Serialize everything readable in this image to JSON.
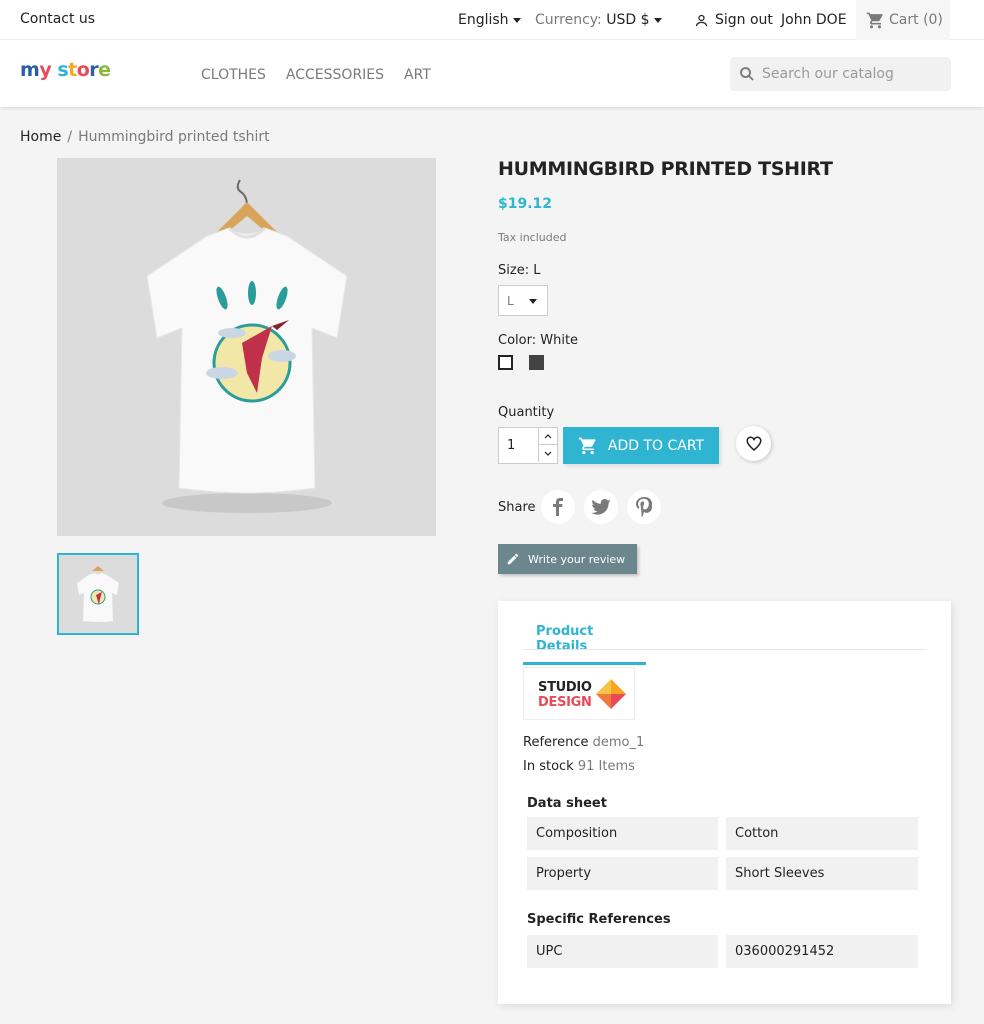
{
  "topbar": {
    "contact": "Contact us",
    "language": "English",
    "currency_label": "Currency:",
    "currency_value": "USD $",
    "signout": "Sign out",
    "user": "John DOE",
    "cart": "Cart",
    "cart_count": "(0)"
  },
  "header": {
    "logo": "my store",
    "nav": [
      "CLOTHES",
      "ACCESSORIES",
      "ART"
    ],
    "search_placeholder": "Search our catalog"
  },
  "breadcrumb": {
    "home": "Home",
    "sep": "/",
    "current": "Hummingbird printed tshirt"
  },
  "product": {
    "title": "HUMMINGBIRD PRINTED TSHIRT",
    "price": "$19.12",
    "tax": "Tax included",
    "size_label": "Size",
    "size_value": "L",
    "color_label": "Color",
    "color_value": "White",
    "colors": [
      "#ffffff",
      "#434343"
    ],
    "quantity_label": "Quantity",
    "quantity_value": "1",
    "add_to_cart": "ADD TO CART",
    "share_label": "Share",
    "review_button": "Write your review"
  },
  "details": {
    "tab": "Product Details",
    "brand_line1": "STUDIO",
    "brand_line2": "DESIGN",
    "reference_label": "Reference",
    "reference_value": "demo_1",
    "stock_label": "In stock",
    "stock_value": "91 Items",
    "data_sheet_title": "Data sheet",
    "data_sheet": [
      {
        "key": "Composition",
        "value": "Cotton"
      },
      {
        "key": "Property",
        "value": "Short Sleeves"
      }
    ],
    "specific_title": "Specific References",
    "specific": [
      {
        "key": "UPC",
        "value": "036000291452"
      }
    ]
  },
  "colors": {
    "accent": "#2fb5d2",
    "review_button": "#6c868e"
  }
}
